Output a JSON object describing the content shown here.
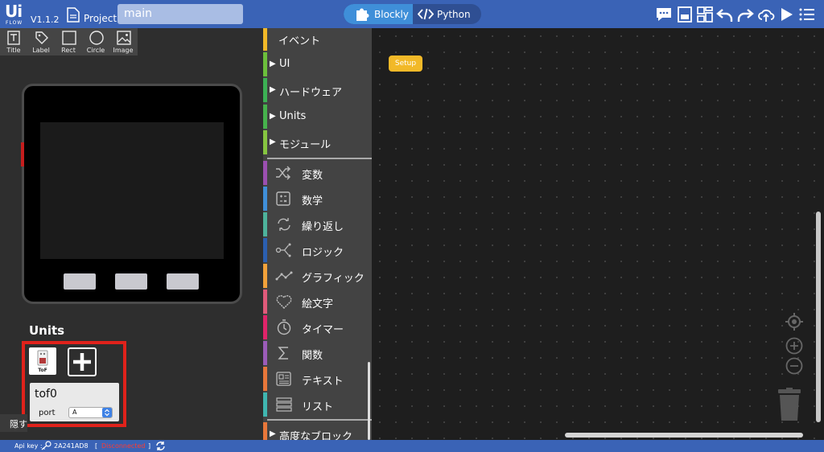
{
  "header": {
    "logo_text": "Ui",
    "logo_sub": "FLOW",
    "version": "V1.1.2",
    "project_label": "Project",
    "file_name": "main",
    "modes": {
      "blockly": "Blockly",
      "python": "Python",
      "active": "Blockly"
    },
    "icons": [
      "chat-icon",
      "save-icon",
      "layout-icon",
      "undo-icon",
      "redo-icon",
      "cloud-upload-icon",
      "run-icon",
      "menu-icon"
    ]
  },
  "ui_tools": [
    {
      "label": "Title",
      "icon": "title-icon"
    },
    {
      "label": "Label",
      "icon": "label-icon"
    },
    {
      "label": "Rect",
      "icon": "rect-icon"
    },
    {
      "label": "Circle",
      "icon": "circle-icon"
    },
    {
      "label": "Image",
      "icon": "image-icon"
    }
  ],
  "units": {
    "title": "Units",
    "card_label": "ToF",
    "unit_name": "tof0",
    "port_label": "port",
    "port_value": "A"
  },
  "hide_tab": "隠す",
  "toolbox": {
    "top_items": [
      {
        "label": "イベント",
        "color": "#f2b928",
        "arrow": false
      },
      {
        "label": "UI",
        "color": "#6cbf3b",
        "arrow": true
      },
      {
        "label": "ハードウェア",
        "color": "#3cb054",
        "arrow": true
      },
      {
        "label": "Units",
        "color": "#46b24c",
        "arrow": true
      },
      {
        "label": "モジュール",
        "color": "#86c540",
        "arrow": true
      }
    ],
    "items": [
      {
        "label": "変数",
        "color": "#9b4fb0",
        "icon": "shuffle-icon"
      },
      {
        "label": "数学",
        "color": "#3f8fd9",
        "icon": "dice-icon"
      },
      {
        "label": "繰り返し",
        "color": "#4db39b",
        "icon": "loop-icon"
      },
      {
        "label": "ロジック",
        "color": "#2b5fb0",
        "icon": "logic-icon"
      },
      {
        "label": "グラフィック",
        "color": "#f2a23a",
        "icon": "graphic-icon"
      },
      {
        "label": "絵文字",
        "color": "#e05a7a",
        "icon": "heart-icon"
      },
      {
        "label": "タイマー",
        "color": "#e0246a",
        "icon": "timer-icon"
      },
      {
        "label": "関数",
        "color": "#9b5cb8",
        "icon": "sigma-icon"
      },
      {
        "label": "テキスト",
        "color": "#e8773a",
        "icon": "text-icon"
      },
      {
        "label": "リスト",
        "color": "#3fb6b0",
        "icon": "list-icon"
      }
    ],
    "advanced": {
      "label": "高度なブロック",
      "color": "#e8773a"
    }
  },
  "workspace": {
    "setup_label": "Setup"
  },
  "status": {
    "api_key_label": "Api key :",
    "api_key_value": "2A241AD8",
    "connection": "Disconnected",
    "connection_color": "#e0221b"
  }
}
